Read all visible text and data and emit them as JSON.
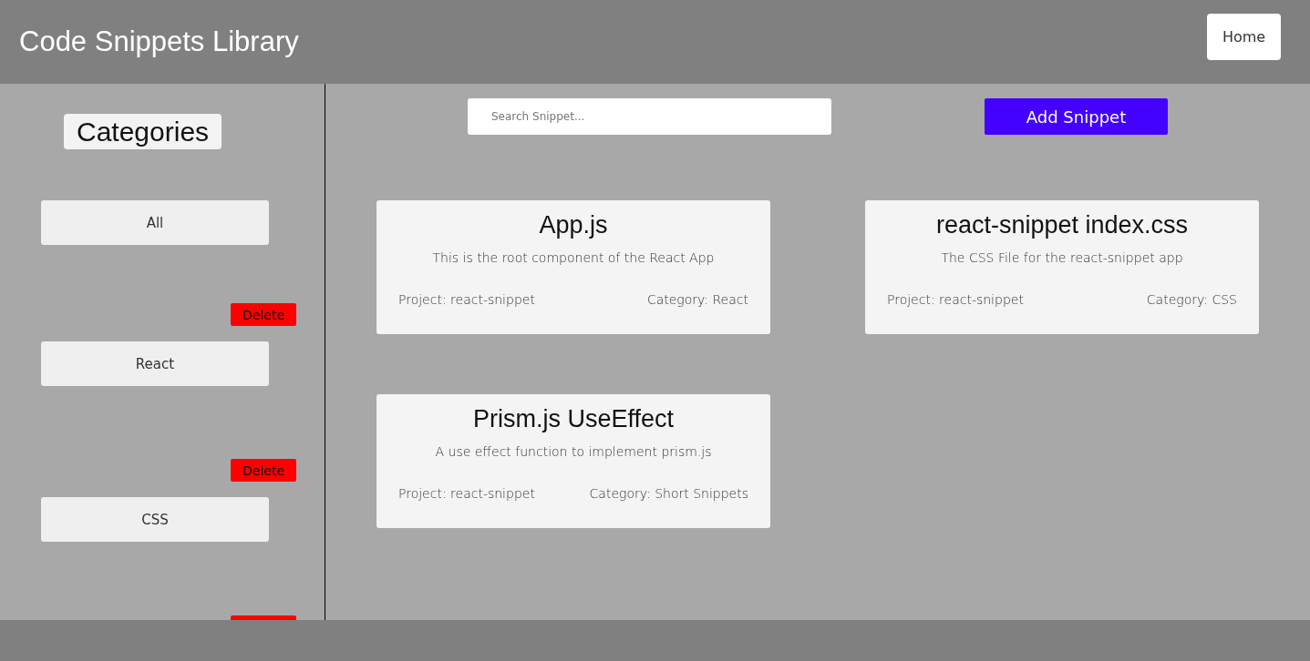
{
  "header": {
    "title": "Code Snippets Library",
    "nav_button": "Home"
  },
  "sidebar": {
    "title": "Categories",
    "categories": [
      {
        "label": "All"
      },
      {
        "label": "React",
        "delete": "Delete"
      },
      {
        "label": "CSS",
        "delete": "Delete"
      }
    ],
    "trailing_delete_cut_off": true
  },
  "toolbar": {
    "search": {
      "placeholder": "Search Snippet..."
    },
    "add_button": "Add Snippet"
  },
  "snippets": [
    {
      "title": "App.js",
      "description": "This is the root component of the React App",
      "project": "Project: react-snippet",
      "category": "Category: React"
    },
    {
      "title": "react-snippet index.css",
      "description": "The CSS File for the react-snippet app",
      "project": "Project: react-snippet",
      "category": "Category: CSS"
    },
    {
      "title": "Prism.js UseEffect",
      "description": "A use effect function to implement prism.js",
      "project": "Project: react-snippet",
      "category": "Category: Short Snippets"
    }
  ]
}
